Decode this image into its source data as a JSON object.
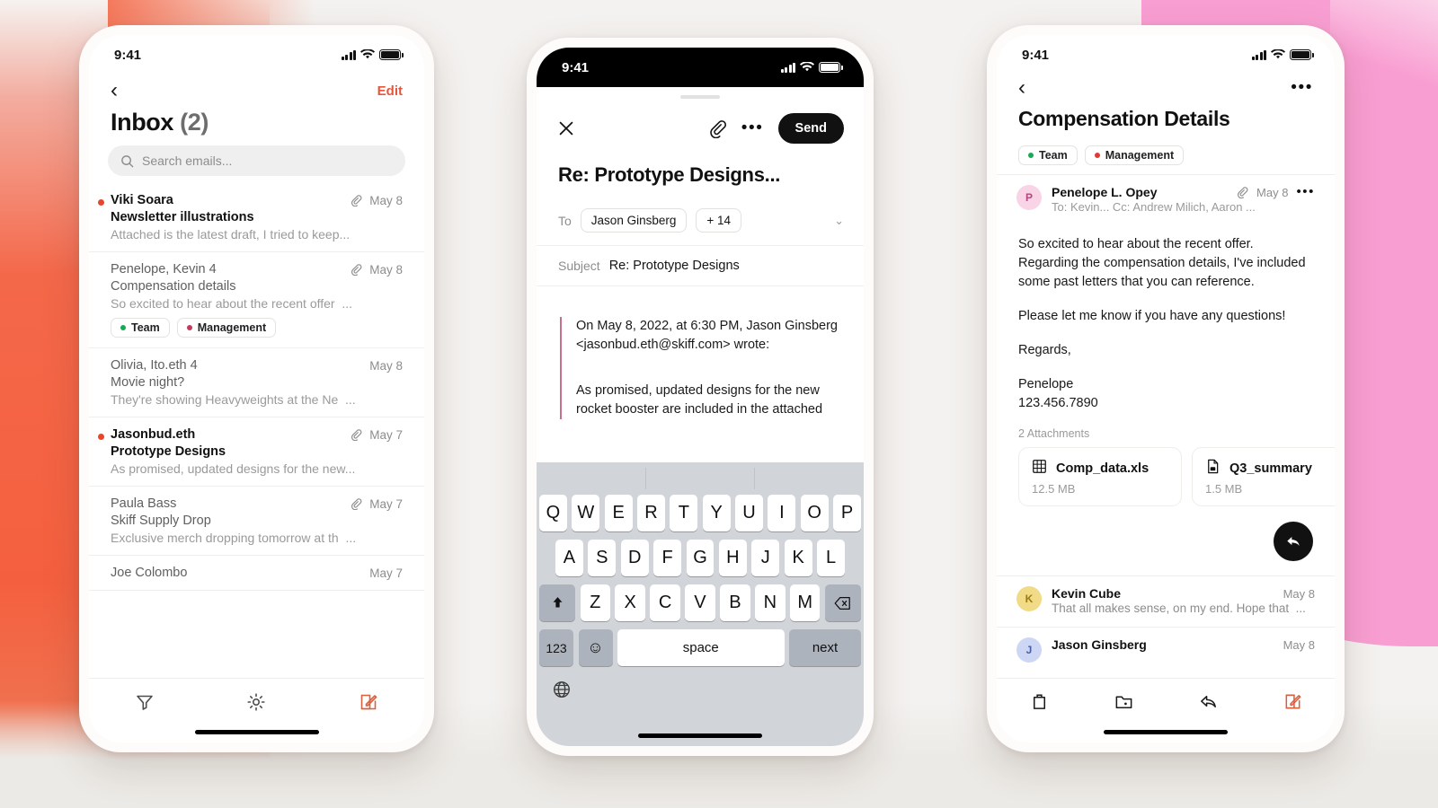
{
  "background": {
    "left_gradient_color": "#f4643f",
    "right_shape_color": "#f99ed2",
    "base_color": "#f4f2f0"
  },
  "phone1": {
    "status": {
      "time": "9:41",
      "signal_icon": "cellular-signal-icon",
      "wifi_icon": "wifi-icon",
      "battery_icon": "battery-icon"
    },
    "nav": {
      "back_icon": "chevron-left-icon",
      "edit_label": "Edit"
    },
    "title": "Inbox",
    "count": "(2)",
    "search": {
      "placeholder": "Search emails...",
      "icon": "search-icon"
    },
    "emails": [
      {
        "sender": "Viki Soara",
        "subject": "Newsletter illustrations",
        "snippet": "Attached is the latest draft, I tried to keep...",
        "date": "May 8",
        "unread": true,
        "attachment": true,
        "tags": []
      },
      {
        "sender": "Penelope, Kevin 4",
        "subject": "Compensation details",
        "snippet": "So excited to hear about the recent offer",
        "date": "May 8",
        "unread": false,
        "attachment": true,
        "tags": [
          {
            "label": "Team",
            "color": "#18a957"
          },
          {
            "label": "Management",
            "color": "#c33b5c"
          }
        ]
      },
      {
        "sender": "Olivia, Ito.eth 4",
        "subject": "Movie night?",
        "snippet": "They're showing Heavyweights at the Ne",
        "date": "May 8",
        "unread": false,
        "attachment": false,
        "tags": []
      },
      {
        "sender": "Jasonbud.eth",
        "subject": "Prototype Designs",
        "snippet": "As promised, updated designs for the new...",
        "date": "May 7",
        "unread": true,
        "attachment": true,
        "tags": []
      },
      {
        "sender": "Paula Bass",
        "subject": "Skiff Supply Drop",
        "snippet": "Exclusive merch dropping tomorrow at th",
        "date": "May 7",
        "unread": false,
        "attachment": true,
        "tags": []
      },
      {
        "sender": "Joe Colombo",
        "subject": "",
        "snippet": "",
        "date": "May 7",
        "unread": false,
        "attachment": false,
        "tags": []
      }
    ],
    "tabbar": [
      {
        "name": "filter-icon",
        "accent": false
      },
      {
        "name": "gear-icon",
        "accent": false
      },
      {
        "name": "compose-icon",
        "accent": true
      }
    ],
    "accent_color": "#d8603f"
  },
  "phone2": {
    "status": {
      "time": "9:41"
    },
    "toolbar": {
      "close_icon": "close-icon",
      "attach_icon": "paperclip-icon",
      "more_icon": "more-horizontal-icon",
      "send_label": "Send"
    },
    "title": "Re: Prototype Designs...",
    "to": {
      "label": "To",
      "chip": "Jason Ginsberg",
      "more_chip": "+ 14",
      "expand_icon": "chevron-down-icon"
    },
    "subject": {
      "label": "Subject",
      "value": "Re: Prototype Designs"
    },
    "quote": [
      "On May 8, 2022, at 6:30 PM, Jason Ginsberg <jasonbud.eth@skiff.com> wrote:",
      "As promised, updated designs for the new rocket booster are included in the attached"
    ],
    "quote_border_color": "#c86f8e",
    "keyboard": {
      "row1": [
        "Q",
        "W",
        "E",
        "R",
        "T",
        "Y",
        "U",
        "I",
        "O",
        "P"
      ],
      "row2": [
        "A",
        "S",
        "D",
        "F",
        "G",
        "H",
        "J",
        "K",
        "L"
      ],
      "row3": [
        "Z",
        "X",
        "C",
        "V",
        "B",
        "N",
        "M"
      ],
      "shift_icon": "shift-icon",
      "backspace_icon": "backspace-icon",
      "numbers_label": "123",
      "emoji_icon": "emoji-icon",
      "space_label": "space",
      "next_label": "next",
      "globe_icon": "globe-icon"
    }
  },
  "phone3": {
    "status": {
      "time": "9:41"
    },
    "nav": {
      "back_icon": "chevron-left-icon",
      "more_icon": "more-horizontal-icon"
    },
    "title": "Compensation Details",
    "tags": [
      {
        "label": "Team",
        "color": "#18a957"
      },
      {
        "label": "Management",
        "color": "#e03a36"
      }
    ],
    "message": {
      "avatar_letter": "P",
      "avatar_color": "#f9d4e6",
      "avatar_text_color": "#b4487e",
      "sender": "Penelope L. Opey",
      "attachment_icon": "paperclip-icon",
      "date": "May 8",
      "more_icon": "more-horizontal-icon",
      "recipients": "To:  Kevin... Cc:  Andrew Milich, Aaron ...",
      "body": [
        "So excited to hear about the recent offer. Regarding the compensation details, I've included some past letters that you can reference.",
        "Please let me know if you have any questions!",
        "Regards,",
        "Penelope\n123.456.7890"
      ]
    },
    "attachments_label": "2 Attachments",
    "attachments": [
      {
        "name": "Comp_data.xls",
        "size": "12.5 MB",
        "icon": "spreadsheet-icon"
      },
      {
        "name": "Q3_summary",
        "size": "1.5 MB",
        "icon": "pdf-file-icon"
      }
    ],
    "reply_fab_icon": "reply-icon",
    "thread": [
      {
        "name": "Kevin Cube",
        "date": "May 8",
        "snippet": "That all makes sense, on my end. Hope that",
        "avatar_letter": "K",
        "avatar_color": "#f2db86",
        "avatar_text_color": "#9a7c12"
      },
      {
        "name": "Jason Ginsberg",
        "date": "May 8",
        "snippet": "",
        "avatar_letter": "J",
        "avatar_color": "#cdd7f5",
        "avatar_text_color": "#4a5fa8"
      }
    ],
    "tabbar": [
      {
        "name": "trash-icon",
        "accent": false
      },
      {
        "name": "move-to-folder-icon",
        "accent": false
      },
      {
        "name": "reply-icon",
        "accent": false
      },
      {
        "name": "compose-icon",
        "accent": true
      }
    ],
    "accent_color": "#d8603f"
  }
}
